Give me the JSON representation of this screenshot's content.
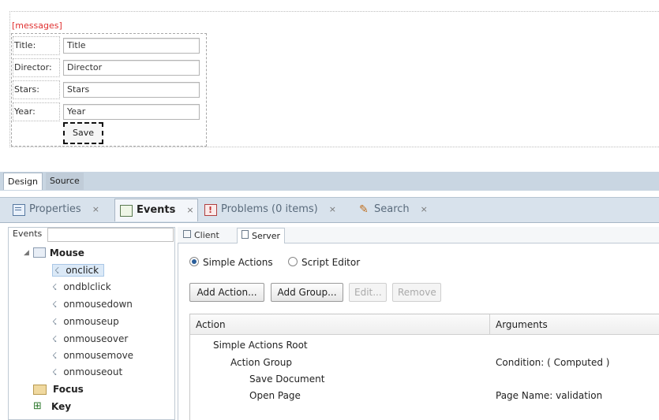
{
  "design": {
    "messages": "[messages]",
    "fields": [
      {
        "label": "Title:",
        "value": "Title"
      },
      {
        "label": "Director:",
        "value": "Director"
      },
      {
        "label": "Stars:",
        "value": "Stars"
      },
      {
        "label": "Year:",
        "value": "Year"
      }
    ],
    "save": "Save"
  },
  "editor_tabs": {
    "design": "Design",
    "source": "Source"
  },
  "views": {
    "properties": "Properties",
    "events": "Events",
    "problems": "Problems (0 items)",
    "search": "Search",
    "close_glyph": "×"
  },
  "events_panel": {
    "label": "Events",
    "categories": {
      "mouse": "Mouse",
      "focus": "Focus",
      "key": "Key"
    },
    "mouse_events": [
      "onclick",
      "ondblclick",
      "onmousedown",
      "onmouseup",
      "onmouseover",
      "onmousemove",
      "onmouseout"
    ],
    "selected": "onclick"
  },
  "right_panel": {
    "tabs": {
      "client": "Client",
      "server": "Server"
    },
    "mode": {
      "simple": "Simple Actions",
      "script": "Script Editor",
      "selected": "simple"
    },
    "buttons": {
      "add_action": "Add Action...",
      "add_group": "Add Group...",
      "edit": "Edit...",
      "remove": "Remove"
    },
    "grid": {
      "headers": {
        "action": "Action",
        "arguments": "Arguments"
      },
      "rows": [
        {
          "action": "Simple Actions Root",
          "arguments": ""
        },
        {
          "action": "Action Group",
          "arguments": "Condition: ( Computed )"
        },
        {
          "action": "Save Document",
          "arguments": ""
        },
        {
          "action": "Open Page",
          "arguments": "Page Name: validation"
        }
      ]
    }
  },
  "colors": {
    "accent": "#2a5e9a",
    "messages": "#e03030",
    "tab_strip": "#d8e2ec"
  }
}
